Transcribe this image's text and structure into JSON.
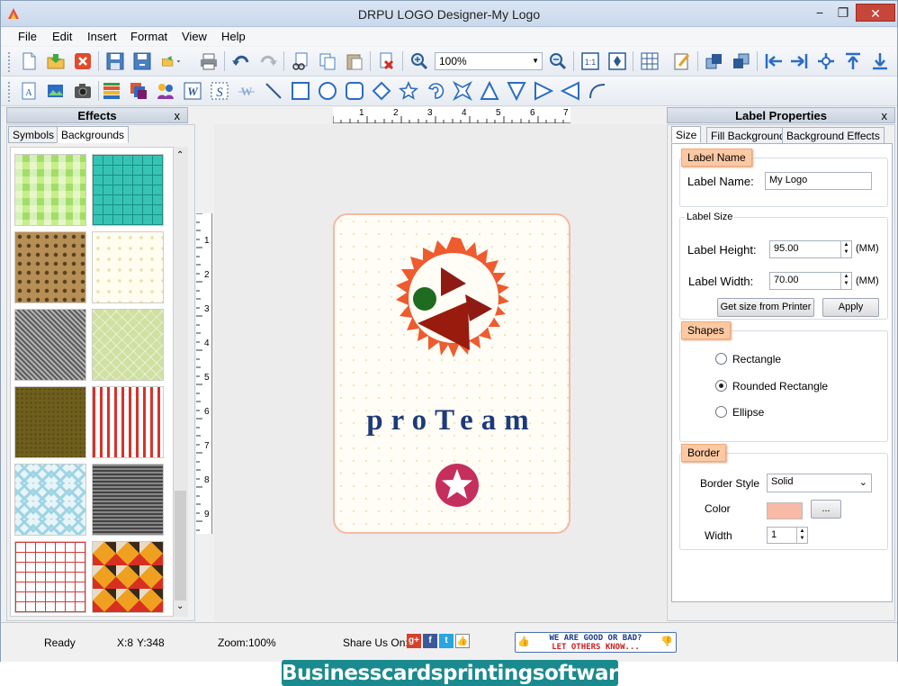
{
  "window": {
    "title": "DRPU LOGO Designer-My Logo",
    "min": "−",
    "max": "❐",
    "close": "✕"
  },
  "menu": [
    "File",
    "Edit",
    "Insert",
    "Format",
    "View",
    "Help"
  ],
  "toolbar": {
    "zoom_value": "100%"
  },
  "effects_panel": {
    "title": "Effects",
    "close": "x",
    "tabs": [
      "Symbols",
      "Backgrounds"
    ],
    "active_tab": "Backgrounds"
  },
  "ruler": {
    "h": [
      "1",
      "2",
      "3",
      "4",
      "5",
      "6",
      "7"
    ],
    "v": [
      "1",
      "2",
      "3",
      "4",
      "5",
      "6",
      "7",
      "8",
      "9"
    ]
  },
  "logo": {
    "text": "proTeam"
  },
  "props_panel": {
    "title": "Label Properties",
    "close": "x",
    "tabs": [
      "Size",
      "Fill Background",
      "Background Effects"
    ],
    "active_tab": "Size",
    "label_name_group": "Label Name",
    "label_name_label": "Label Name:",
    "label_name_value": "My Logo",
    "label_size_group": "Label Size",
    "height_label": "Label Height:",
    "height_value": "95.00",
    "height_unit": "(MM)",
    "width_label": "Label Width:",
    "width_value": "70.00",
    "width_unit": "(MM)",
    "get_size_button": "Get size from Printer",
    "apply_button": "Apply",
    "shapes_group": "Shapes",
    "shapes": [
      "Rectangle",
      "Rounded Rectangle",
      "Ellipse"
    ],
    "selected_shape": "Rounded Rectangle",
    "border_group": "Border",
    "border_style_label": "Border Style",
    "border_style_value": "Solid",
    "color_label": "Color",
    "border_color": "#f8b9a6",
    "color_button": "...",
    "width_label2": "Width",
    "border_width": "1"
  },
  "status": {
    "ready": "Ready",
    "x": "X:8",
    "y": "Y:348",
    "zoom": "Zoom:100%",
    "share": "Share Us On:",
    "feedback_line1": "WE ARE GOOD OR BAD?",
    "feedback_line2": "LET OTHERS KNOW..."
  },
  "banner": {
    "text": "Businesscardsprintingsoftware.com"
  }
}
